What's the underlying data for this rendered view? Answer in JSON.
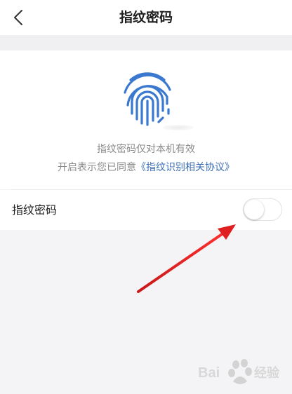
{
  "header": {
    "title": "指纹密码",
    "back_icon": "chevron-left-icon"
  },
  "fingerprint": {
    "icon": "fingerprint-icon",
    "color": "#3b78d0",
    "note": "指纹密码仅对本机有效",
    "agree_prefix": "开启表示您已同意",
    "agree_link": "《指纹识别相关协议》"
  },
  "setting": {
    "label": "指纹密码",
    "toggle_state": "off"
  },
  "annotation": {
    "arrow_color": "#e02020",
    "arrow_icon": "red-arrow-icon"
  },
  "watermark": {
    "text": "Baidu 经验",
    "icon": "baidu-paw-icon"
  }
}
